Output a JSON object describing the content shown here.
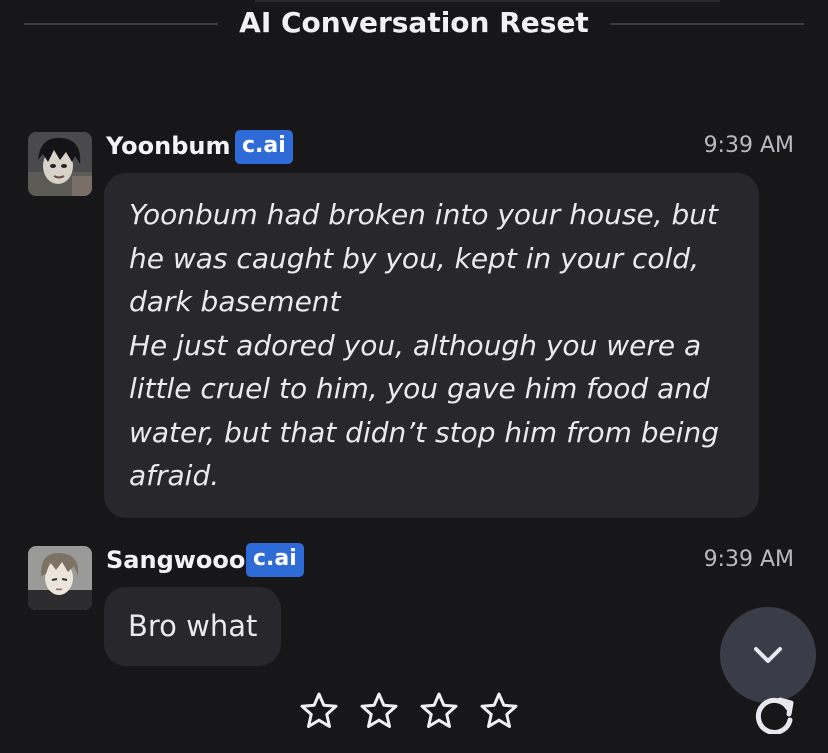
{
  "divider": {
    "title": "AI Conversation Reset"
  },
  "messages": [
    {
      "author": "Yoonbum",
      "badge": "c.ai",
      "time": "9:39 AM",
      "lines": [
        "Yoonbum had broken into your house, but he was caught by you, kept in your cold, dark basement",
        "He just adored you, although you were a little cruel to him, you gave him food and water, but that didn’t stop him from being afraid."
      ],
      "avatar_icon": "character-avatar"
    },
    {
      "author": "Sangwooo",
      "badge": "c.ai",
      "time": "9:39 AM",
      "text": "Bro what",
      "avatar_icon": "character-avatar"
    }
  ],
  "rating": {
    "stars": 4,
    "selected": 0,
    "star_icon": "star-outline-icon"
  },
  "controls": {
    "scroll_down_icon": "chevron-down-icon",
    "regenerate_icon": "refresh-icon"
  },
  "colors": {
    "background": "#17171a",
    "bubble": "#27272c",
    "badge": "#2f6bd6",
    "scroll_button": "#3a3d47"
  }
}
